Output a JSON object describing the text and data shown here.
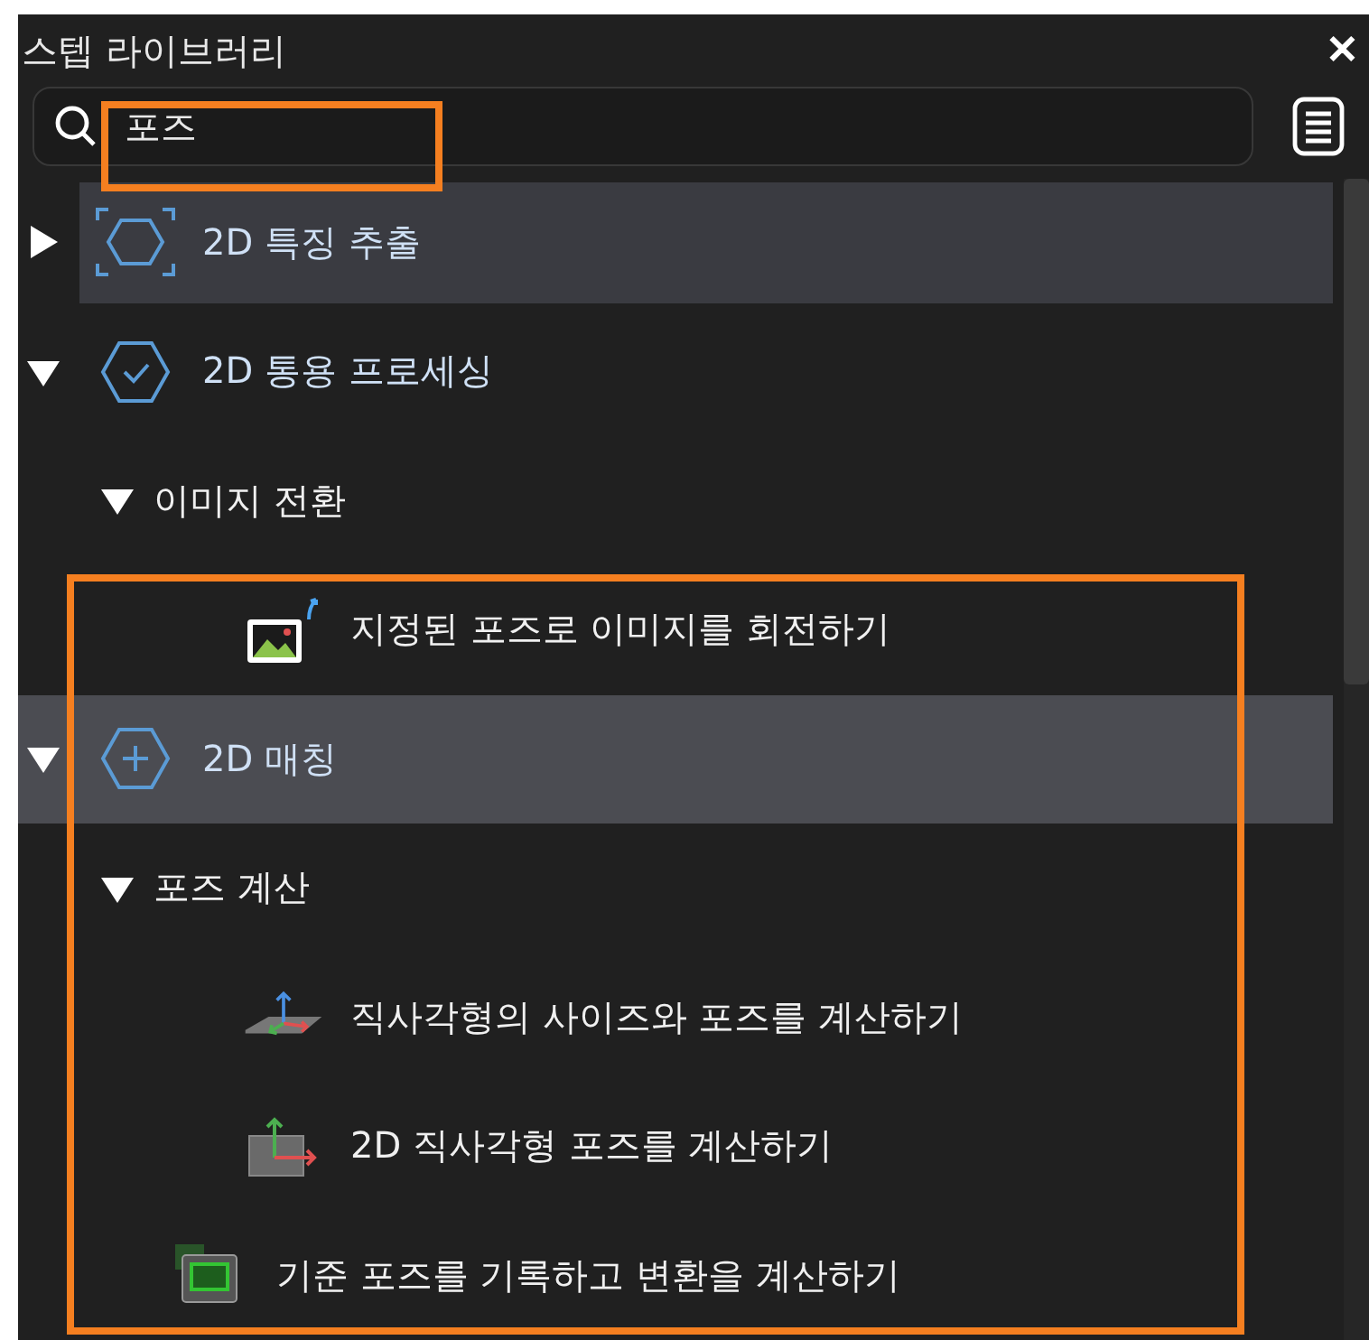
{
  "panel": {
    "title": "스텝 라이브러리",
    "close_label": "✕"
  },
  "search": {
    "value": "포즈"
  },
  "tree": [
    {
      "label": "2D 특징 추출",
      "kind": "hexagon-bracket",
      "expanded": false,
      "selected": false,
      "hovered": true
    },
    {
      "label": "2D 통용 프로세싱",
      "kind": "hexagon-check",
      "expanded": true,
      "selected": false,
      "hovered": false,
      "children": [
        {
          "label": "이미지 전환",
          "kind": "group",
          "expanded": true,
          "selected": false,
          "hovered": false,
          "children": [
            {
              "label": "지정된 포즈로 이미지를 회전하기",
              "kind": "image-rotate",
              "selected": false,
              "hovered": false
            }
          ]
        }
      ]
    },
    {
      "label": "2D 매칭",
      "kind": "hexagon-plus",
      "expanded": true,
      "selected": true,
      "hovered": false,
      "children": [
        {
          "label": "포즈 계산",
          "kind": "group",
          "expanded": true,
          "selected": false,
          "hovered": false,
          "children": [
            {
              "label": "직사각형의 사이즈와 포즈를 계산하기",
              "kind": "rect-pose-3d",
              "selected": false,
              "hovered": false
            },
            {
              "label": "2D 직사각형 포즈를 계산하기",
              "kind": "rect-pose-2d",
              "selected": false,
              "hovered": false
            }
          ]
        },
        {
          "label": "기준 포즈를 기록하고 변환을 계산하기",
          "kind": "record-pose",
          "selected": false,
          "hovered": false
        }
      ]
    }
  ]
}
